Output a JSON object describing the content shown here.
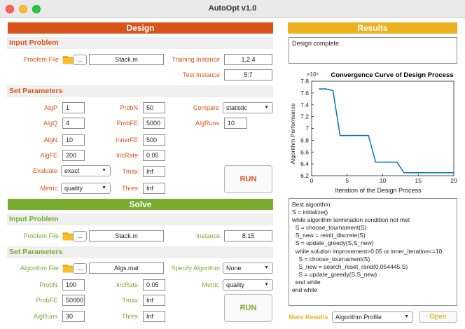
{
  "window": {
    "title": "AutoOpt v1.0"
  },
  "colors": {
    "orange": "#d95319",
    "green": "#77ac30",
    "results_band": "#edb120",
    "line": "#0072bd"
  },
  "design": {
    "band_label": "Design",
    "input_problem": {
      "header": "Input Problem",
      "problem_file_label": "Problem File",
      "browse_label": "...",
      "problem_file_value": "Stack.m",
      "training_instance_label": "Training Instance",
      "training_instance_value": "1,2,4",
      "test_instance_label": "Test Instance",
      "test_instance_value": "5:7"
    },
    "set_parameters": {
      "header": "Set Parameters",
      "algp_label": "AlgP",
      "algp_value": "1",
      "algq_label": "AlgQ",
      "algq_value": "4",
      "algn_label": "AlgN",
      "algn_value": "10",
      "algfe_label": "AlgFE",
      "algfe_value": "200",
      "evaluate_label": "Evaluate",
      "evaluate_value": "exact",
      "metric_label": "Metric",
      "metric_value": "quality",
      "probn_label": "ProbN",
      "probn_value": "50",
      "probfe_label": "ProbFE",
      "probfe_value": "5000",
      "innerfe_label": "InnerFE",
      "innerfe_value": "500",
      "incrate_label": "IncRate",
      "incrate_value": "0.05",
      "tmax_label": "Tmax",
      "tmax_value": "Inf",
      "thres_label": "Thres",
      "thres_value": "Inf",
      "compare_label": "Compare",
      "compare_value": "statistic",
      "algruns_label": "AlgRuns",
      "algruns_value": "10",
      "run_label": "RUN"
    }
  },
  "solve": {
    "band_label": "Solve",
    "input_problem": {
      "header": "Input Problem",
      "problem_file_label": "Problem File",
      "browse_label": "...",
      "problem_file_value": "Stack.m",
      "instance_label": "Instance",
      "instance_value": "8:15"
    },
    "set_parameters": {
      "header": "Set Parameters",
      "algorithm_file_label": "Algorithm File",
      "browse_label": "...",
      "algorithm_file_value": "Algs.mat",
      "specify_algorithm_label": "Specify Algorithm",
      "specify_algorithm_value": "None",
      "probn_label": "ProbN",
      "probn_value": "100",
      "probfe_label": "ProbFE",
      "probfe_value": "50000",
      "algruns_label": "AlgRuns",
      "algruns_value": "30",
      "incrate_label": "IncRate",
      "incrate_value": "0.05",
      "tmax_label": "Tmax",
      "tmax_value": "Inf",
      "thres_label": "Thres",
      "thres_value": "Inf",
      "metric_label": "Metric",
      "metric_value": "quality",
      "run_label": "RUN"
    }
  },
  "results": {
    "band_label": "Results",
    "status_text": "Design complete.",
    "algorithm_text": [
      "Best algorithm:",
      "S = initialize()",
      "while algorithm termination condition not met",
      "  S = choose_tournament(S)",
      "  S_new = reinit_discrete(S)",
      "  S = update_greedy(S,S_new)",
      "  while solution improvement>0.05 or inner_iteration<=10",
      "    S = choose_tournament(S)",
      "    S_new = search_reset_rand(0.054445,S)",
      "    S = update_greedy(S,S_new)",
      "  end while",
      "end while"
    ],
    "more_results_label": "More Results",
    "more_results_value": "Algorithm Profile",
    "open_label": "Open"
  },
  "chart_data": {
    "type": "line",
    "title": "Convergence Curve of Design Process",
    "xlabel": "Iteration of the Design Process",
    "ylabel": "Algorithm Performance",
    "y_exponent_label": "×10⁴",
    "xlim": [
      0,
      20
    ],
    "ylim": [
      6.2,
      7.8
    ],
    "x_ticks": [
      0,
      5,
      10,
      15,
      20
    ],
    "y_ticks": [
      6.2,
      6.4,
      6.6,
      6.8,
      7.0,
      7.2,
      7.4,
      7.6,
      7.8
    ],
    "y_tick_labels": [
      "6.2",
      "6.4",
      "6.6",
      "6.8",
      "7",
      "7.2",
      "7.4",
      "7.6",
      "7.8"
    ],
    "grid": false,
    "series": [
      {
        "x": [
          1,
          2,
          3,
          4,
          5,
          6,
          7,
          8,
          9,
          10,
          11,
          12,
          13,
          14,
          15,
          16,
          17,
          18,
          19,
          20
        ],
        "y": [
          7.67,
          7.67,
          7.64,
          6.88,
          6.88,
          6.88,
          6.88,
          6.88,
          6.43,
          6.43,
          6.43,
          6.43,
          6.25,
          6.25,
          6.25,
          6.25,
          6.25,
          6.25,
          6.25,
          6.25
        ]
      }
    ]
  }
}
